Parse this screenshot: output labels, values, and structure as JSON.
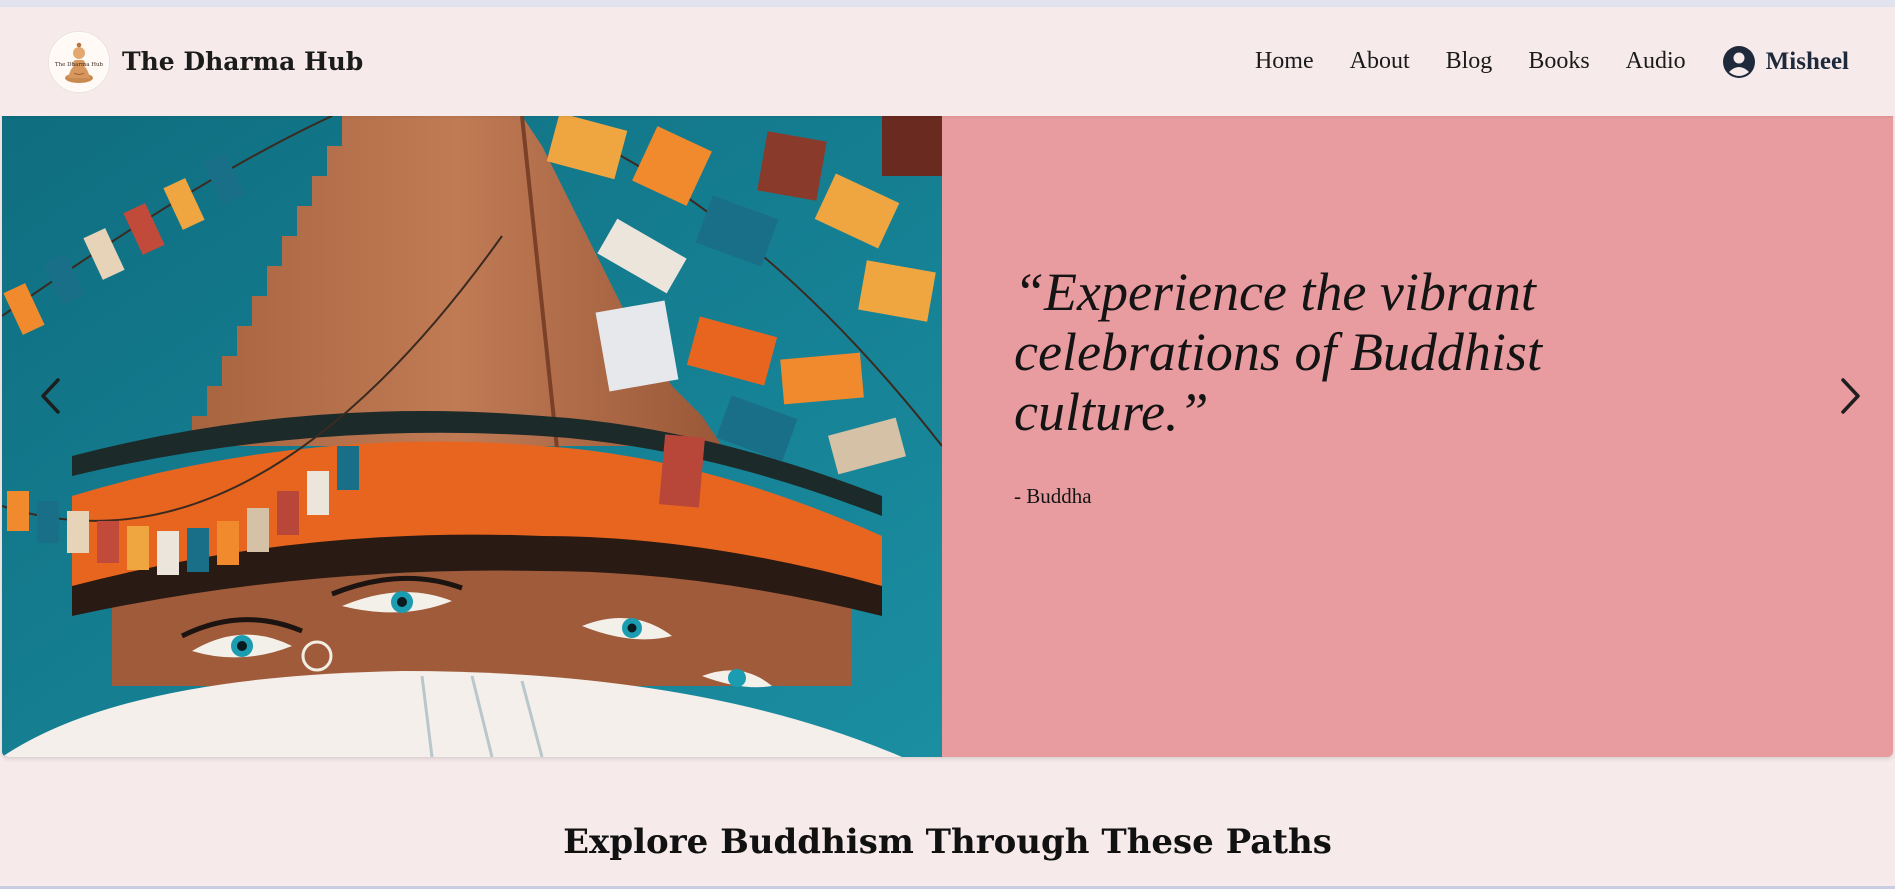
{
  "header": {
    "brand_name": "The Dharma Hub",
    "logo_text": "The Dharma Hub",
    "nav": [
      {
        "label": "Home"
      },
      {
        "label": "About"
      },
      {
        "label": "Blog"
      },
      {
        "label": "Books"
      },
      {
        "label": "Audio"
      }
    ],
    "user_name": "Misheel"
  },
  "hero": {
    "quote": "“Experience the vibrant celebrations of Buddhist culture.”",
    "author": "- Buddha",
    "image_subject": "stupa-with-prayer-flags",
    "colors": {
      "quote_panel": "#e99c9f",
      "sky": "#167f93"
    },
    "prev_icon": "chevron-left-icon",
    "next_icon": "chevron-right-icon"
  },
  "sections": {
    "explore_title": "Explore Buddhism Through These Paths"
  }
}
